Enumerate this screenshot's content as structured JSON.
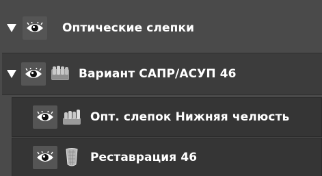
{
  "tree": {
    "group": {
      "label": "Оптические слепки",
      "expanded": true,
      "visible": true
    },
    "variant": {
      "label": "Вариант САПР/АСУП 46",
      "expanded": true,
      "visible": true,
      "icon": "dental-model-icon"
    },
    "items": [
      {
        "label": "Опт. слепок Нижняя челюсть",
        "visible": true,
        "icon": "lower-jaw-scan-icon"
      },
      {
        "label": "Реставрация 46",
        "visible": true,
        "icon": "restoration-tooth-icon"
      }
    ]
  },
  "colors": {
    "background": "#4a4a4a",
    "variant_row": "#3c3c3c",
    "item_row": "#353535",
    "eye_button": "#555555",
    "text": "#ffffff"
  }
}
